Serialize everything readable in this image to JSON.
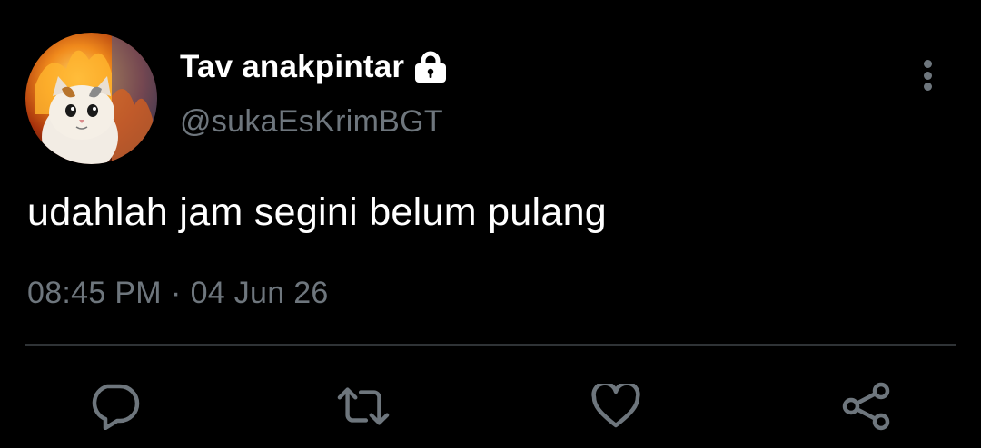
{
  "tweet": {
    "author": {
      "display_name": "Tav anakpintar",
      "handle": "@sukaEsKrimBGT",
      "protected_icon": "lock-icon",
      "avatar": "cat-on-fire-avatar"
    },
    "text": "udahlah jam segini belum pulang",
    "time": "08:45 PM",
    "separator": "·",
    "date": "04 Jun 26"
  },
  "actions": {
    "reply_icon": "reply-icon",
    "retweet_icon": "retweet-icon",
    "like_icon": "like-icon",
    "share_icon": "share-icon",
    "more_icon": "more-icon"
  },
  "colors": {
    "background": "#000000",
    "primary_text": "#ffffff",
    "secondary_text": "#6e767d",
    "divider": "#2f3336"
  }
}
